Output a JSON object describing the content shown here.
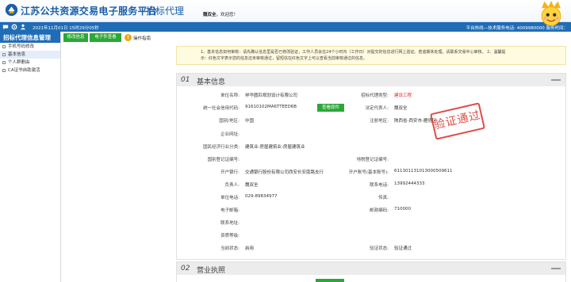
{
  "header": {
    "site_title": "江苏公共资源交易电子服务平台",
    "page_name": "招标代理",
    "welcome_user": "魏双全",
    "welcome_suffix": "，欢迎您！"
  },
  "infobar": {
    "datetime": "2021年11月01日 15时29分05秒",
    "hotline": "平台热线—技术服务电话: 4009980000 服务时间：",
    "icons": [
      "chat-icon",
      "settings-icon",
      "users-icon"
    ]
  },
  "sidebar": {
    "title": "招标代理信息管理",
    "items": [
      {
        "label": "手机号码修改",
        "active": false
      },
      {
        "label": "基本信息",
        "active": true
      },
      {
        "label": "个人群删由",
        "active": false
      },
      {
        "label": "CA证书自助激活",
        "active": false
      }
    ]
  },
  "toolbar": {
    "modify_label": "修改信息",
    "view_docs_label": "电子件查看",
    "help_icon_glyph": "!",
    "help_label": "操作指南"
  },
  "notice": {
    "line1": "1、基本信息如何审核：请先确认信息里是否已修改验证，工作人员会在24个小时内（工作日）对提交的信息进行网上验证。若逾期未处理，请联系交易中心审核。 2、温馨提",
    "line2": "示：红色文字表示您的信息还未审核通过，留短信在红色文字上可以查看当前审核通过的信息。"
  },
  "section1": {
    "num": "01",
    "title": "基本信息",
    "view_license_btn": "查看原件",
    "stamp_text": "验证通过",
    "left_fields": [
      {
        "label": "单位名称:",
        "value": "祥华圆匹规划设计有限公司"
      },
      {
        "label": "统一社会信用代码:",
        "value": "91610102MA6TTEED6B"
      },
      {
        "label": "国别/地区:",
        "value": "中国"
      },
      {
        "label": "企业网址:",
        "value": ""
      },
      {
        "label": "国民经济行业分类:",
        "value": "建筑业-房屋建筑业-房屋建筑业"
      },
      {
        "label": "国别登记证编号:",
        "value": ""
      },
      {
        "label": "开户银行:",
        "value": "交通银行股份有限公司西安长安南路支行"
      },
      {
        "label": "负责人:",
        "value": "魏双全"
      },
      {
        "label": "单位电话:",
        "value": "029-89834977"
      },
      {
        "label": "电子邮箱:",
        "value": ""
      },
      {
        "label": "联系地址:",
        "value": ""
      },
      {
        "label": "资质等级:",
        "value": ""
      },
      {
        "label": "当前状态:",
        "value": "启用"
      }
    ],
    "right_fields": [
      {
        "label": "招标代理类型:",
        "value": "建设工程",
        "red": true
      },
      {
        "label": "法定代表人:",
        "value": "魏双全",
        "red": false
      },
      {
        "label": "注册地区:",
        "value": "陕西省-西安市-雁塔区",
        "red": false
      },
      {
        "label": "地税登记证编号:",
        "value": "",
        "red": false
      },
      {
        "label": "开户账号(基本账号):",
        "value": "611301131013000509611",
        "red": false
      },
      {
        "label": "联系电话:",
        "value": "13992444333",
        "red": false
      },
      {
        "label": "传真:",
        "value": "",
        "red": false
      },
      {
        "label": "邮政编码:",
        "value": "710000",
        "red": false
      },
      {
        "label": "验证状态:",
        "value": "验证通过",
        "red": false
      }
    ]
  },
  "section2": {
    "num": "02",
    "title": "营业执照"
  },
  "colors": {
    "brand_blue": "#1f6cb7",
    "button_green": "#2aa836",
    "stamp_red": "#d92e24"
  }
}
